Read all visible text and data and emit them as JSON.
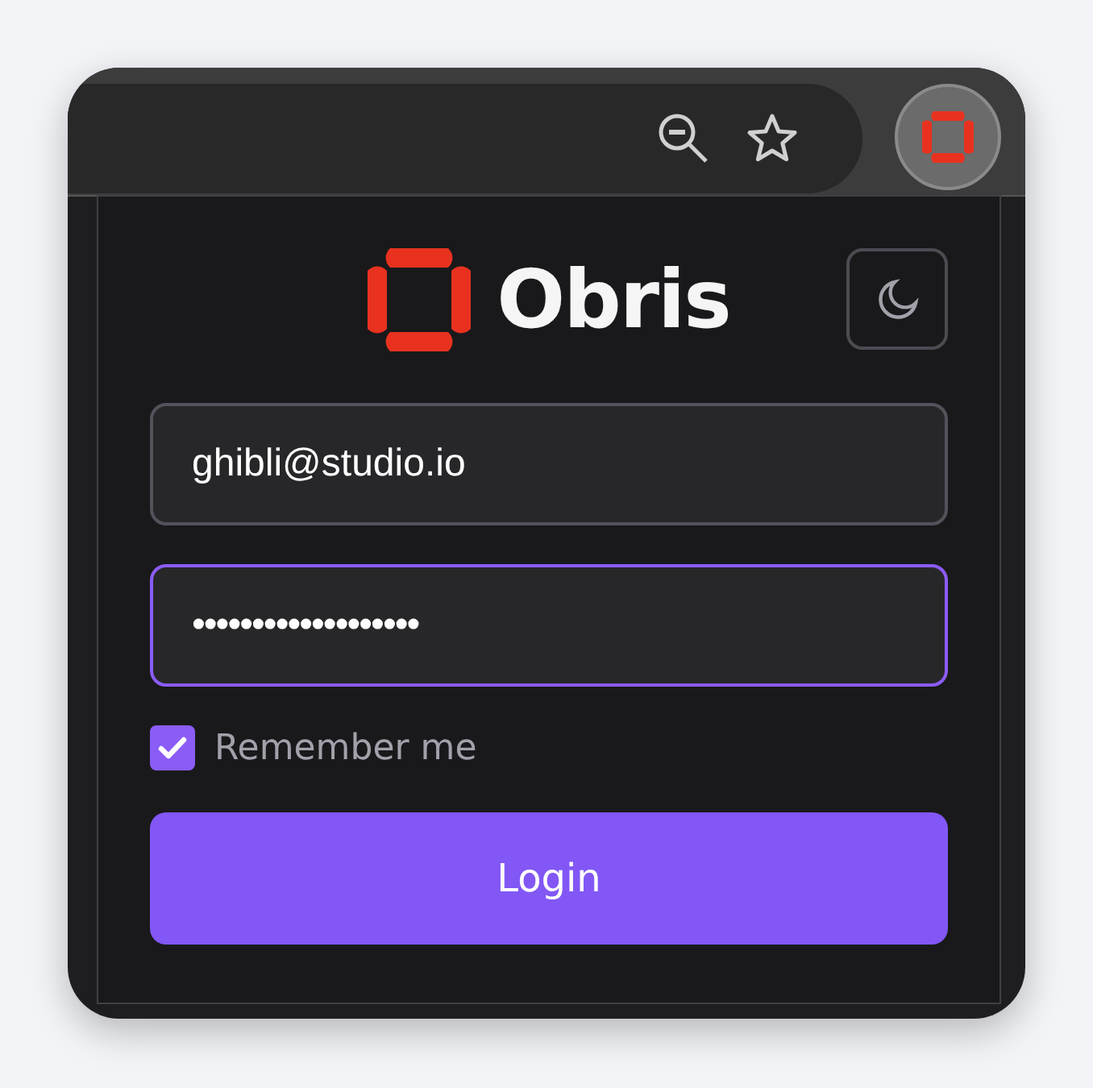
{
  "brand": {
    "name": "Obris"
  },
  "theme_toggle": {
    "dark": true
  },
  "fields": [
    {
      "kind": "email",
      "value": "ghibli@studio.io",
      "focused": false
    },
    {
      "kind": "password",
      "value": "•••••••••••••••••••",
      "focused": true
    }
  ],
  "remember": {
    "label": "Remember me",
    "checked": true
  },
  "login_button": {
    "label": "Login"
  }
}
